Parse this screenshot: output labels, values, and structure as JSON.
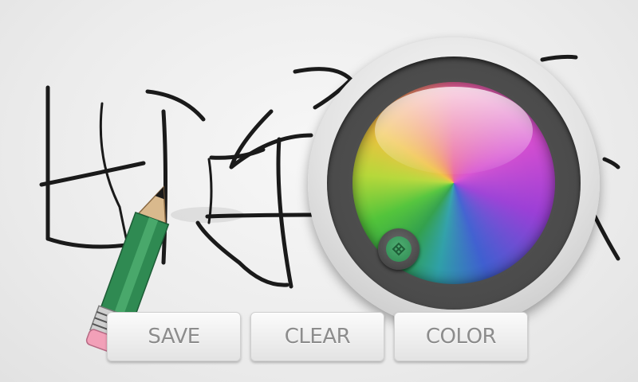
{
  "buttons": {
    "save": "SAVE",
    "clear": "CLEAR",
    "color": "COLOR"
  },
  "color_picker": {
    "selected_color": "#2f8a52"
  },
  "icons": {
    "pencil": "pencil-icon",
    "knob": "color-selector-knob-icon"
  },
  "colors": {
    "stroke": "#1a1a1a",
    "pencil_body": "#2f8a52",
    "pencil_eraser": "#f2a0b8",
    "button_text": "#8c8c8c"
  }
}
